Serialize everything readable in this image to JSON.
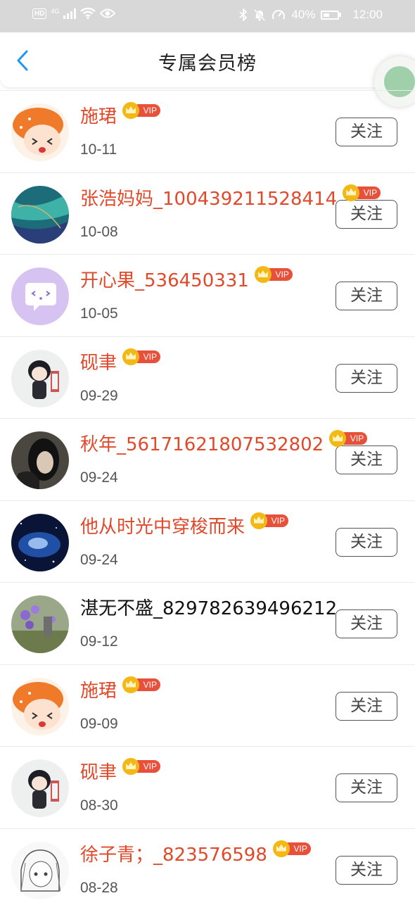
{
  "status_bar": {
    "left": {
      "hd": "HD",
      "network": "4G"
    },
    "right": {
      "battery": "40%",
      "time": "12:00"
    },
    "icons": [
      "bluetooth-icon",
      "mute-icon",
      "speed-icon",
      "wifi-icon",
      "eye-icon"
    ]
  },
  "header": {
    "title": "专属会员榜"
  },
  "colors": {
    "vip_name": "#e04a2b",
    "plain_name": "#111111",
    "vip_badge": "#e8503a",
    "crown": "#f3b814"
  },
  "vip_label": "VIP",
  "follow_label": "关注",
  "members": [
    {
      "name": "施珺",
      "date": "10-11",
      "vip": true,
      "avatar": "orange-hood-cartoon"
    },
    {
      "name": "张浩妈妈_100439211528414",
      "date": "10-08",
      "vip": true,
      "avatar": "teal-marble"
    },
    {
      "name": "开心果_536450331",
      "date": "10-05",
      "vip": true,
      "avatar": "purple-chat-bubble"
    },
    {
      "name": "砚聿",
      "date": "09-29",
      "vip": true,
      "avatar": "chibi-boy"
    },
    {
      "name": "秋年_56171621807532802",
      "date": "09-24",
      "vip": true,
      "avatar": "dark-hair-portrait"
    },
    {
      "name": "他从时光中穿梭而来",
      "date": "09-24",
      "vip": true,
      "avatar": "galaxy"
    },
    {
      "name": "湛无不盛_829782639496212",
      "date": "09-12",
      "vip": false,
      "avatar": "purple-flowers"
    },
    {
      "name": "施珺",
      "date": "09-09",
      "vip": true,
      "avatar": "orange-hood-cartoon"
    },
    {
      "name": "砚聿",
      "date": "08-30",
      "vip": true,
      "avatar": "chibi-boy"
    },
    {
      "name": "徐子青；_823576598",
      "date": "08-28",
      "vip": true,
      "avatar": "sketch-girl"
    }
  ]
}
